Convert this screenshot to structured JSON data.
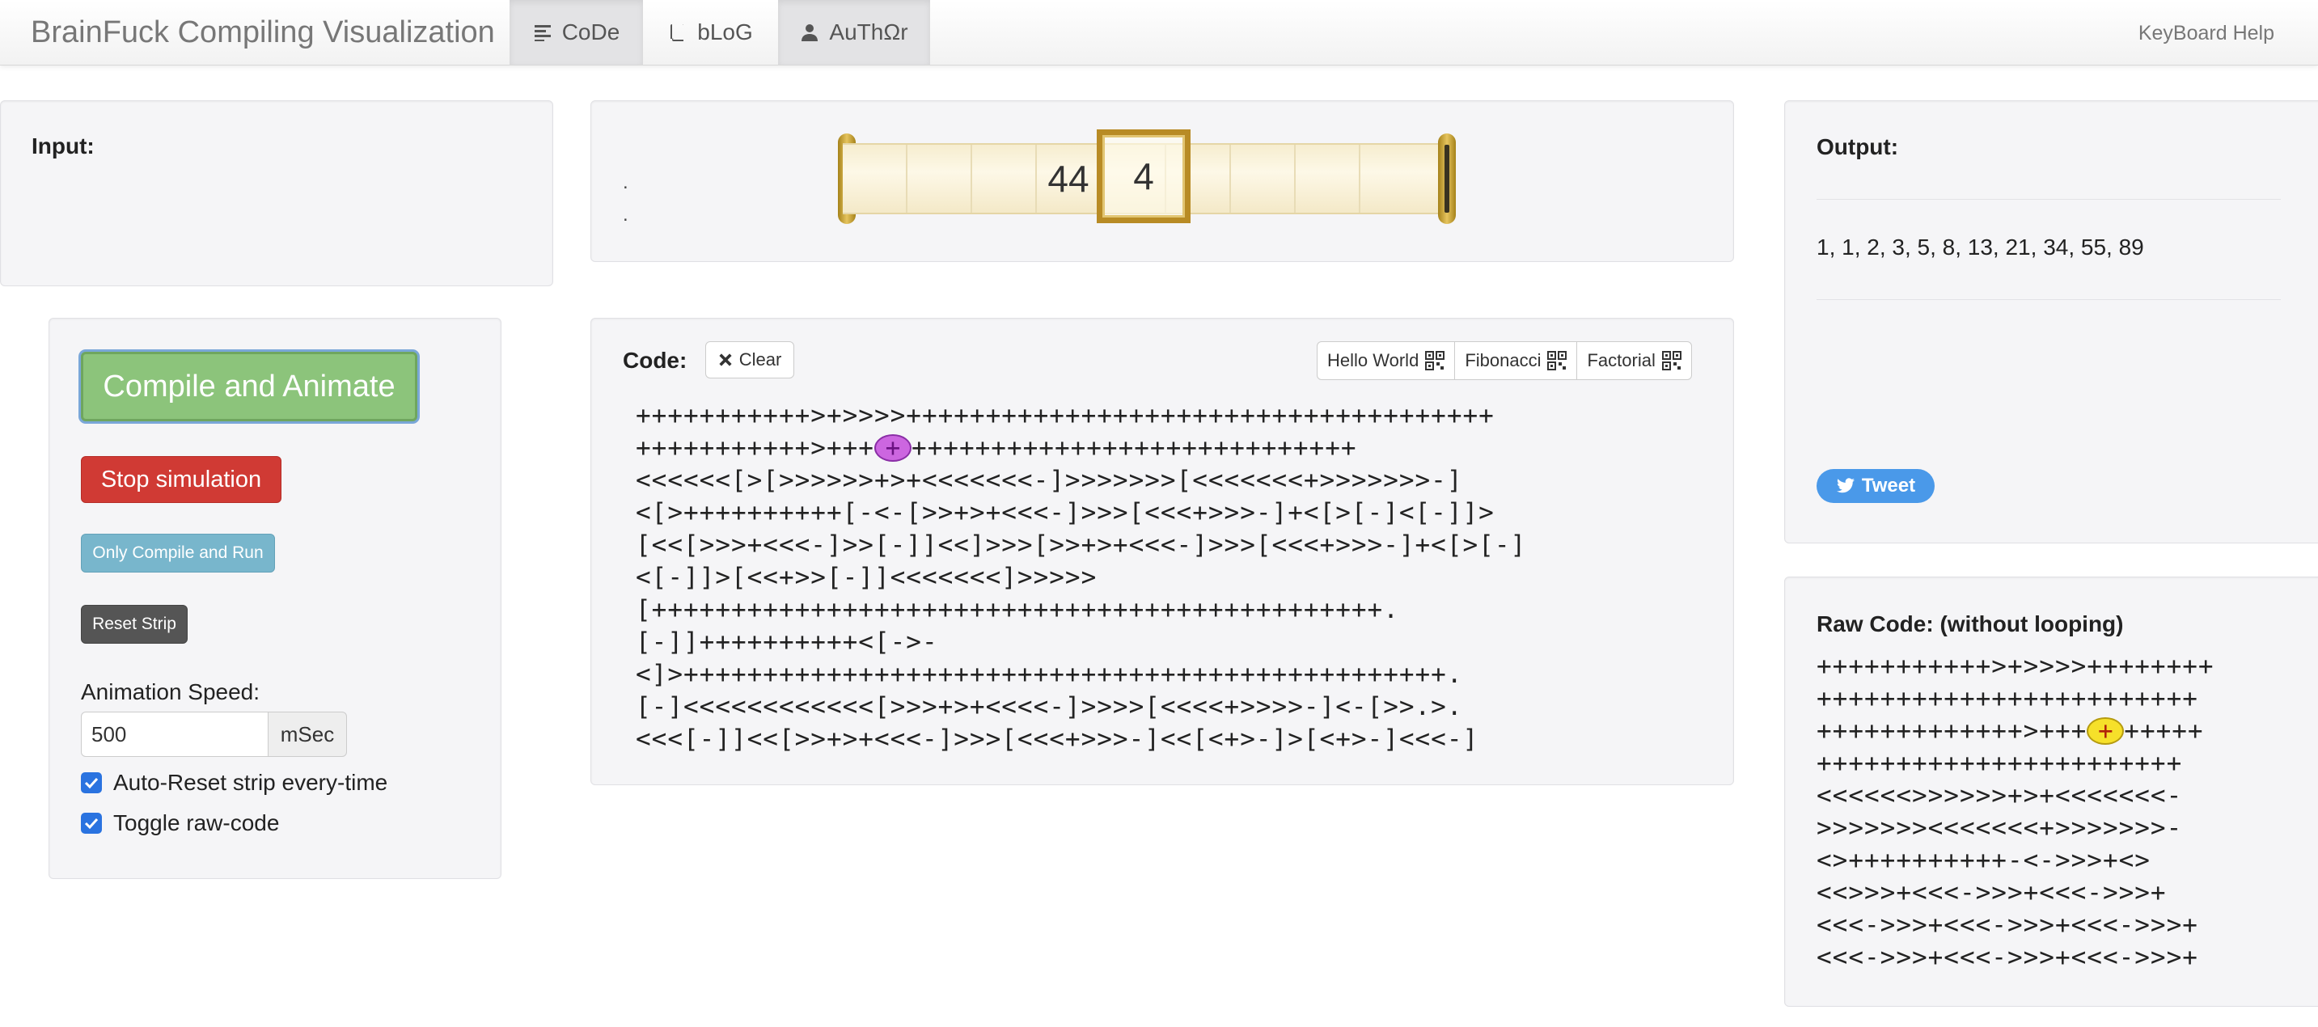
{
  "navbar": {
    "brand": "BrainFuck Compiling Visualization",
    "tabs": [
      {
        "label": "CoDe",
        "icon": "align-left-icon"
      },
      {
        "label": "bLoG",
        "icon": "book-icon"
      },
      {
        "label": "AuThΩr",
        "icon": "user-icon"
      }
    ],
    "keyboard_help": "KeyBoard Help"
  },
  "input_panel": {
    "label": "Input:"
  },
  "strip": {
    "dots": [
      ".",
      "."
    ],
    "cells": [
      "",
      "",
      "",
      "44",
      "",
      "",
      "",
      "",
      ""
    ],
    "current_value": "4"
  },
  "controls": {
    "compile_animate": "Compile and Animate",
    "stop_simulation": "Stop simulation",
    "only_compile_run": "Only Compile and Run",
    "reset_strip": "Reset Strip",
    "animation_speed_label": "Animation Speed:",
    "animation_speed_value": "500",
    "speed_unit": "mSec",
    "auto_reset_label": "Auto-Reset strip every-time",
    "auto_reset_checked": true,
    "toggle_raw_label": "Toggle raw-code",
    "toggle_raw_checked": true
  },
  "code_panel": {
    "label": "Code:",
    "clear_button": "Clear",
    "presets": [
      "Hello World",
      "Fibonacci",
      "Factorial"
    ],
    "lines": [
      {
        "before": "+++++++++++>+>>>>+++++++++++++++++++++++++++++++++++++",
        "hl": "",
        "after": ""
      },
      {
        "before": "+++++++++++>+++",
        "hl": "+",
        "after": "++++++++++++++++++++++++++++"
      },
      {
        "before": "<<<<<<[>[>>>>>>+>+<<<<<<<-]>>>>>>>[<<<<<<<+>>>>>>>-]",
        "hl": "",
        "after": ""
      },
      {
        "before": "<[>++++++++++[-<-[>>+>+<<<-]>>>[<<<+>>>-]+<[>[-]<[-]]>",
        "hl": "",
        "after": ""
      },
      {
        "before": "[<<[>>>+<<<-]>>[-]]<<]>>>[>>+>+<<<-]>>>[<<<+>>>-]+<[>[-]",
        "hl": "",
        "after": ""
      },
      {
        "before": "<[-]]>[<<+>>[-]]<<<<<<<]>>>>>",
        "hl": "",
        "after": ""
      },
      {
        "before": "[++++++++++++++++++++++++++++++++++++++++++++++.",
        "hl": "",
        "after": ""
      },
      {
        "before": "[-]]++++++++++<[->-",
        "hl": "",
        "after": ""
      },
      {
        "before": "<]>++++++++++++++++++++++++++++++++++++++++++++++++.",
        "hl": "",
        "after": ""
      },
      {
        "before": "[-]<<<<<<<<<<<<[>>>+>+<<<<-]>>>>[<<<<+>>>>-]<-[>>.>.",
        "hl": "",
        "after": ""
      },
      {
        "before": "<<<[-]]<<[>>+>+<<<-]>>>[<<<+>>>-]<<[<+>-]>[<+>-]<<<-]",
        "hl": "",
        "after": ""
      }
    ]
  },
  "output_panel": {
    "label": "Output:",
    "text": "1, 1, 2, 3, 5, 8, 13, 21, 34, 55, 89",
    "tweet_label": "Tweet"
  },
  "raw_panel": {
    "label": "Raw Code: (without looping)",
    "lines": [
      {
        "before": "+++++++++++>+>>>>++++++++",
        "hl": "",
        "after": ""
      },
      {
        "before": "++++++++++++++++++++++++",
        "hl": "",
        "after": ""
      },
      {
        "before": "+++++++++++++>+++",
        "hl": "+",
        "after": "+++++"
      },
      {
        "before": "+++++++++++++++++++++++",
        "hl": "",
        "after": ""
      },
      {
        "before": "<<<<<<>>>>>>+>+<<<<<<<-",
        "hl": "",
        "after": ""
      },
      {
        "before": ">>>>>>><<<<<<<+>>>>>>>-",
        "hl": "",
        "after": ""
      },
      {
        "before": "<>++++++++++-<->>>+<>",
        "hl": "",
        "after": ""
      },
      {
        "before": "<<>>>+<<<->>>+<<<->>>+",
        "hl": "",
        "after": ""
      },
      {
        "before": "<<<->>>+<<<->>>+<<<->>>+",
        "hl": "",
        "after": ""
      },
      {
        "before": "<<<->>>+<<<->>>+<<<->>>+",
        "hl": "",
        "after": ""
      }
    ]
  }
}
